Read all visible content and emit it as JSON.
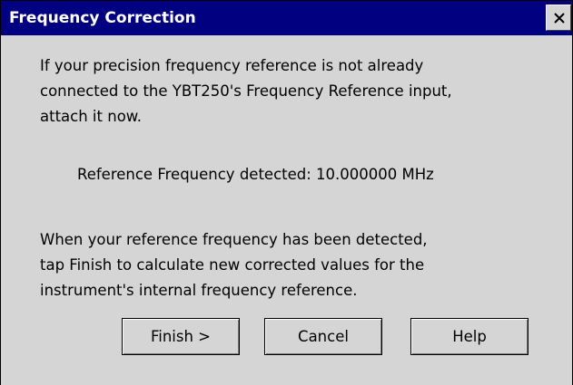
{
  "window": {
    "title": "Frequency Correction"
  },
  "content": {
    "intro_lines": [
      "If your precision frequency reference is not already",
      "connected to the YBT250's Frequency Reference input,",
      "attach it now."
    ],
    "detected_label": "Reference Frequency detected:",
    "detected_value": "10.000000 MHz",
    "instruction_lines": [
      "When your reference frequency has been detected,",
      "tap Finish to calculate new corrected values for the",
      "instrument's internal frequency reference."
    ]
  },
  "buttons": {
    "finish": "Finish >",
    "cancel": "Cancel",
    "help": "Help"
  },
  "icons": {
    "close": "close-icon"
  },
  "colors": {
    "titlebar": "#000080",
    "dialog_bg": "#d5d5d5"
  }
}
